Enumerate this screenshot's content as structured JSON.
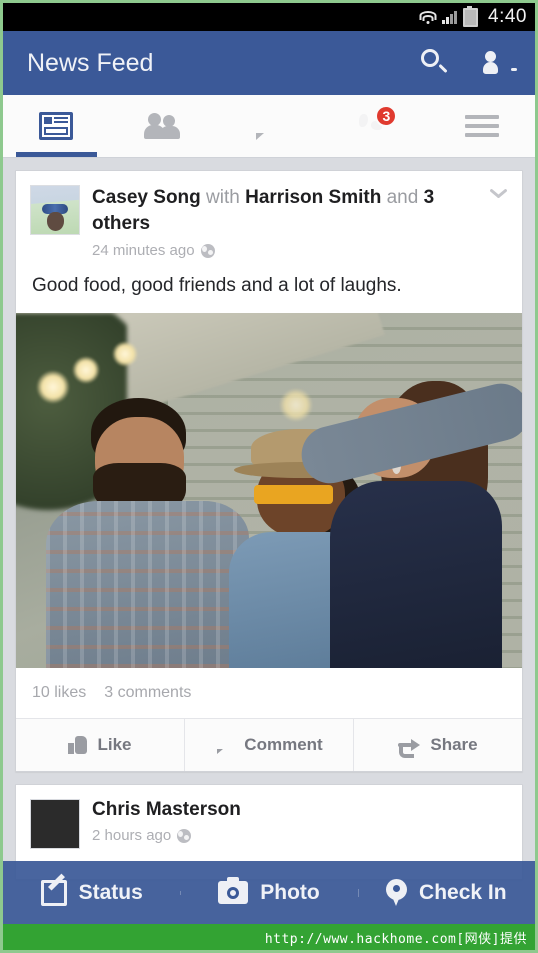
{
  "status_bar": {
    "time": "4:40",
    "icons": [
      "wifi-icon",
      "cellular-signal-icon",
      "battery-icon"
    ]
  },
  "app_bar": {
    "title": "News Feed",
    "search_icon": "search-icon",
    "contacts_icon": "contacts-icon"
  },
  "tabs": [
    {
      "name": "news-feed",
      "icon": "news-feed-icon",
      "active": true,
      "badge": ""
    },
    {
      "name": "friends",
      "icon": "friends-icon",
      "active": false,
      "badge": ""
    },
    {
      "name": "messages",
      "icon": "messages-icon",
      "active": false,
      "badge": ""
    },
    {
      "name": "notifications",
      "icon": "globe-icon",
      "active": false,
      "badge": "3"
    },
    {
      "name": "more",
      "icon": "hamburger-menu-icon",
      "active": false,
      "badge": ""
    }
  ],
  "post": {
    "author": "Casey Song",
    "with_word": "with",
    "tagged": "Harrison Smith",
    "and_word": "and",
    "others": "3 others",
    "time": "24 minutes ago",
    "privacy_icon": "public-globe-icon",
    "caret_icon": "chevron-down-icon",
    "text": "Good food, good friends and a lot of laughs.",
    "photo_alt": "three friends laughing outdoors on a porch",
    "likes": "10 likes",
    "comments": "3 comments",
    "actions": [
      {
        "label": "Like",
        "icon": "thumbs-up-icon"
      },
      {
        "label": "Comment",
        "icon": "speech-bubble-icon"
      },
      {
        "label": "Share",
        "icon": "share-arrow-icon"
      }
    ]
  },
  "next_post": {
    "author": "Chris Masterson",
    "time": "2 hours ago"
  },
  "composer": [
    {
      "label": "Status",
      "icon": "status-compose-icon"
    },
    {
      "label": "Photo",
      "icon": "camera-icon"
    },
    {
      "label": "Check In",
      "icon": "map-pin-icon"
    }
  ],
  "watermark": {
    "text": "http://www.hackhome.com[网侠]提供"
  },
  "colors": {
    "brand_blue": "#3b5998",
    "badge_red": "#e03a2f",
    "page_bg": "#d9dbe0",
    "watermark_green": "#33a333"
  }
}
